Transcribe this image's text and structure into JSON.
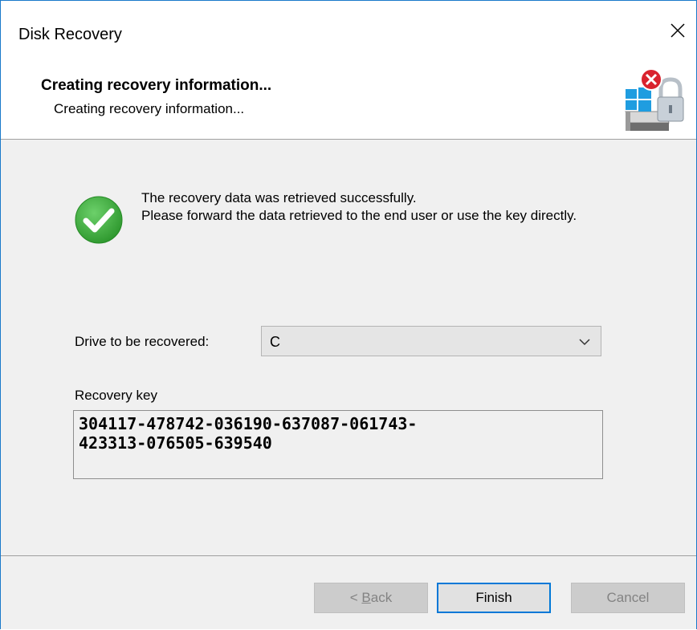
{
  "window": {
    "title": "Disk Recovery",
    "close_icon": "close-icon"
  },
  "header": {
    "title": "Creating recovery information...",
    "subtitle": "Creating recovery information...",
    "icon": "disk-lock-error-icon"
  },
  "status": {
    "icon": "success-check-icon",
    "line1": "The recovery data was retrieved successfully.",
    "line2": "Please forward the data retrieved to the end user or use the key directly."
  },
  "drive": {
    "label": "Drive to be recovered:",
    "selected": "C"
  },
  "recovery_key": {
    "label": "Recovery key",
    "line1": "304117-478742-036190-637087-061743-",
    "line2": "423313-076505-639540"
  },
  "buttons": {
    "back_prefix": "< ",
    "back_label": "Back",
    "finish_label": "Finish",
    "cancel_label": "Cancel"
  },
  "colors": {
    "accent": "#0078d7",
    "success": "#3aa83a",
    "error": "#d9232e",
    "window_border": "#1979ca"
  }
}
